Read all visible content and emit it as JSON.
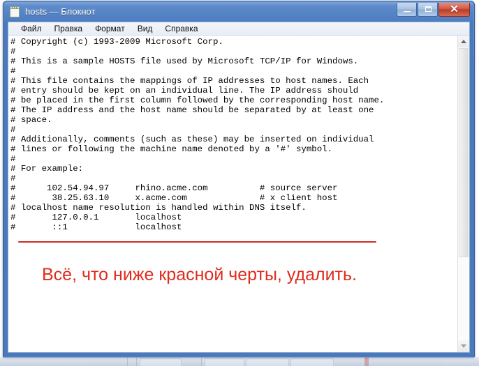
{
  "window": {
    "title": "hosts — Блокнот",
    "icon": "notepad-icon",
    "controls": {
      "minimize": "—",
      "maximize": "□",
      "close": "✕"
    }
  },
  "menu": {
    "items": [
      {
        "label": "Файл"
      },
      {
        "label": "Правка"
      },
      {
        "label": "Формат"
      },
      {
        "label": "Вид"
      },
      {
        "label": "Справка"
      }
    ]
  },
  "editor": {
    "text": "# Copyright (c) 1993-2009 Microsoft Corp.\n#\n# This is a sample HOSTS file used by Microsoft TCP/IP for Windows.\n#\n# This file contains the mappings of IP addresses to host names. Each\n# entry should be kept on an individual line. The IP address should\n# be placed in the first column followed by the corresponding host name.\n# The IP address and the host name should be separated by at least one\n# space.\n#\n# Additionally, comments (such as these) may be inserted on individual\n# lines or following the machine name denoted by a '#' symbol.\n#\n# For example:\n#\n#      102.54.94.97     rhino.acme.com          # source server\n#       38.25.63.10     x.acme.com              # x client host\n# localhost name resolution is handled within DNS itself.\n#       127.0.0.1       localhost\n#       ::1             localhost",
    "lines": [
      "# Copyright (c) 1993-2009 Microsoft Corp.",
      "#",
      "# This is a sample HOSTS file used by Microsoft TCP/IP for Windows.",
      "#",
      "# This file contains the mappings of IP addresses to host names. Each",
      "# entry should be kept on an individual line. The IP address should",
      "# be placed in the first column followed by the corresponding host name.",
      "# The IP address and the host name should be separated by at least one",
      "# space.",
      "#",
      "# Additionally, comments (such as these) may be inserted on individual",
      "# lines or following the machine name denoted by a '#' symbol.",
      "#",
      "# For example:",
      "#",
      "#      102.54.94.97     rhino.acme.com          # source server",
      "#       38.25.63.10     x.acme.com              # x client host",
      "# localhost name resolution is handled within DNS itself.",
      "#       127.0.0.1       localhost",
      "#       ::1             localhost"
    ]
  },
  "annotation": {
    "note_text": "Всё, что ниже красной черты, удалить.",
    "note_color": "#e02b1d",
    "rule_color": "#cf2a22"
  },
  "scrollbar": {
    "up_arrow": "▲",
    "down_arrow": "▼"
  },
  "colors": {
    "title_bar_blue": "#4a7abd",
    "frame_border": "#2e5c9a",
    "close_button_red": "#bc3c2a",
    "menu_background": "#eef3f9"
  }
}
